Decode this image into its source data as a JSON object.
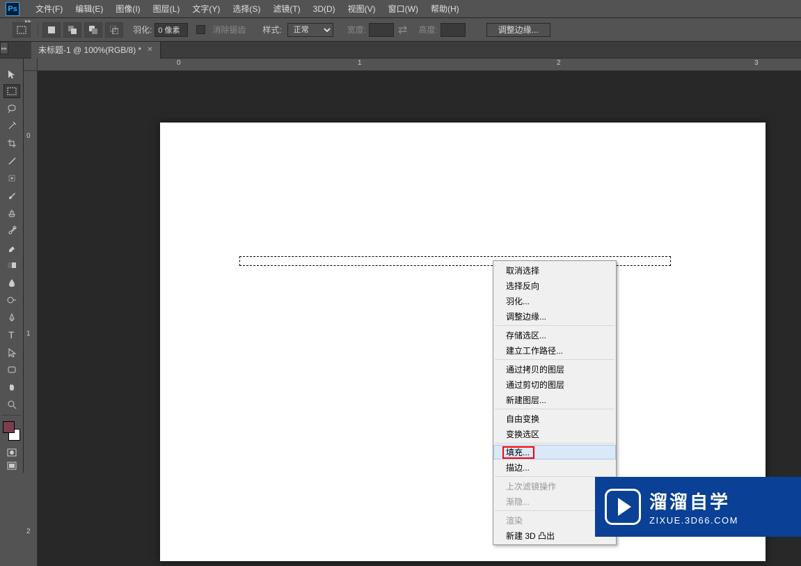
{
  "app": {
    "logo": "Ps"
  },
  "menubar": [
    "文件(F)",
    "编辑(E)",
    "图像(I)",
    "图层(L)",
    "文字(Y)",
    "选择(S)",
    "滤镜(T)",
    "3D(D)",
    "视图(V)",
    "窗口(W)",
    "帮助(H)"
  ],
  "options": {
    "feather_label": "羽化:",
    "feather_value": "0 像素",
    "antialias": "消除锯齿",
    "style_label": "样式:",
    "style_value": "正常",
    "width_label": "宽度:",
    "height_label": "高度:",
    "refine_edge": "调整边缘..."
  },
  "tab": {
    "title": "未标题-1 @ 100%(RGB/8) *"
  },
  "ruler_h": [
    {
      "pos": 204,
      "label": "0"
    },
    {
      "pos": 484,
      "label": "1"
    },
    {
      "pos": 770,
      "label": "2"
    },
    {
      "pos": 1054,
      "label": "3"
    }
  ],
  "ruler_v": [
    {
      "pos": 92,
      "label": "0"
    },
    {
      "pos": 376,
      "label": "1"
    },
    {
      "pos": 660,
      "label": "2"
    }
  ],
  "context_menu": [
    {
      "label": "取消选择",
      "type": "item"
    },
    {
      "label": "选择反向",
      "type": "item"
    },
    {
      "label": "羽化...",
      "type": "item"
    },
    {
      "label": "调整边缘...",
      "type": "item"
    },
    {
      "type": "sep"
    },
    {
      "label": "存储选区...",
      "type": "item"
    },
    {
      "label": "建立工作路径...",
      "type": "item"
    },
    {
      "type": "sep"
    },
    {
      "label": "通过拷贝的图层",
      "type": "item"
    },
    {
      "label": "通过剪切的图层",
      "type": "item"
    },
    {
      "label": "新建图层...",
      "type": "item"
    },
    {
      "type": "sep"
    },
    {
      "label": "自由变换",
      "type": "item"
    },
    {
      "label": "变换选区",
      "type": "item"
    },
    {
      "type": "sep"
    },
    {
      "label": "填充...",
      "type": "item",
      "highlight": true,
      "red_box": true
    },
    {
      "label": "描边...",
      "type": "item"
    },
    {
      "type": "sep"
    },
    {
      "label": "上次滤镜操作",
      "type": "item",
      "disabled": true
    },
    {
      "label": "渐隐...",
      "type": "item",
      "disabled": true
    },
    {
      "type": "sep"
    },
    {
      "label": "渲染",
      "type": "item",
      "disabled": true
    },
    {
      "label": "新建 3D 凸出",
      "type": "item"
    }
  ],
  "watermark": {
    "title": "溜溜自学",
    "sub": "ZIXUE.3D66.COM"
  }
}
